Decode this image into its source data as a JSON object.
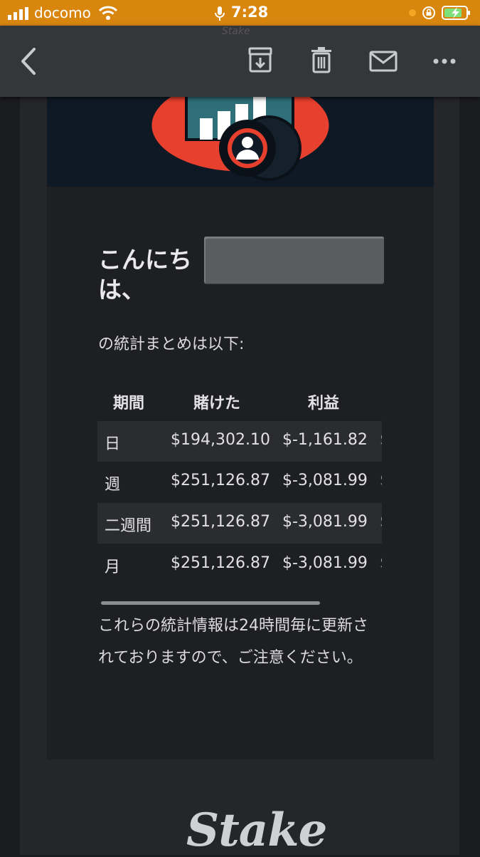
{
  "status_bar": {
    "carrier": "docomo",
    "time": "7:28"
  },
  "toolbar": {
    "faint_text": "Stake",
    "icons": [
      "back-icon",
      "archive-icon",
      "trash-icon",
      "mail-icon",
      "more-icon"
    ]
  },
  "email": {
    "greeting": "こんにちは、",
    "intro": "の統計まとめは以下:",
    "table": {
      "headers": [
        "期間",
        "賭けた",
        "利益",
        ""
      ],
      "rows": [
        [
          "日",
          "$194,302.10",
          "$-1,161.82",
          "$"
        ],
        [
          "週",
          "$251,126.87",
          "$-3,081.99",
          "$"
        ],
        [
          "二週間",
          "$251,126.87",
          "$-3,081.99",
          "$"
        ],
        [
          "月",
          "$251,126.87",
          "$-3,081.99",
          "$"
        ]
      ]
    },
    "note": "これらの統計情報は24時間毎に更新されておりますので、ご注意ください。",
    "footer_logo": "Stake"
  },
  "colors": {
    "status_bar": "#d9860f",
    "toolbar": "#35363a",
    "banner_bg": "#0f1925",
    "banner_accent": "#e8402e"
  }
}
